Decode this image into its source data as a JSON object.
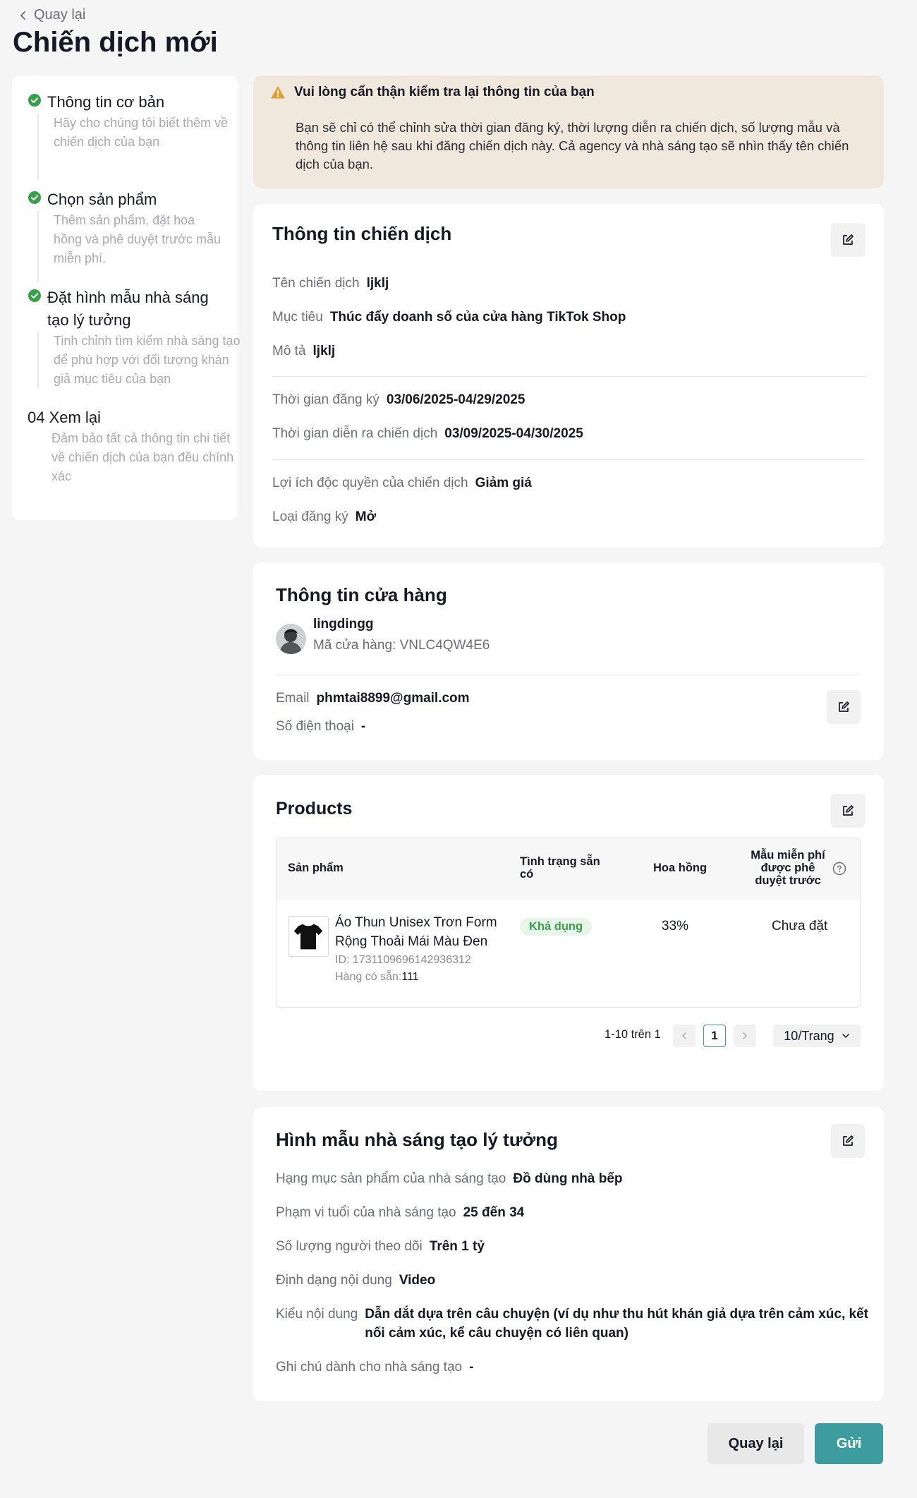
{
  "header": {
    "back_label": "Quay lại",
    "title": "Chiến dịch mới"
  },
  "steps": [
    {
      "title": "Thông tin cơ bản",
      "desc": "Hãy cho chúng tôi biết thêm về chiến dịch của bạn",
      "status": "done"
    },
    {
      "title": "Chọn sản phẩm",
      "desc": "Thêm sản phẩm, đặt hoa hồng và phê duyệt trước mẫu miễn phí.",
      "status": "done"
    },
    {
      "title": "Đặt hình mẫu nhà sáng tạo lý tưởng",
      "desc": "Tinh chỉnh tìm kiếm nhà sáng tạo để phù hợp với đối tượng khán giả mục tiêu của bạn",
      "status": "done"
    },
    {
      "title": "04 Xem lại",
      "desc": "Đảm bảo tất cả thông tin chi tiết về chiến dịch của bạn đều chính xác",
      "status": "current"
    }
  ],
  "warning": {
    "title": "Vui lòng cẩn thận kiểm tra lại thông tin của bạn",
    "body": "Bạn sẽ chỉ có thể chỉnh sửa thời gian đăng ký, thời lượng diễn ra chiến dịch, số lượng mẫu và thông tin liên hệ sau khi đăng chiến dịch này. Cả agency và nhà sáng tạo sẽ nhìn thấy tên chiến dịch của bạn."
  },
  "campaign": {
    "title": "Thông tin chiến dịch",
    "name_label": "Tên chiến dịch",
    "name": "ljklj",
    "goal_label": "Mục tiêu",
    "goal": "Thúc đẩy doanh số của cửa hàng TikTok Shop",
    "desc_label": "Mô tả",
    "desc": "ljklj",
    "reg_label": "Thời gian đăng ký",
    "reg": "03/06/2025-04/29/2025",
    "run_label": "Thời gian diễn ra chiến dịch",
    "run": "03/09/2025-04/30/2025",
    "benefit_label": "Lợi ích độc quyền của chiến dịch",
    "benefit": "Giảm giá",
    "type_label": "Loại đăng ký",
    "type": "Mở"
  },
  "shop": {
    "title": "Thông tin cửa hàng",
    "name": "lingdingg",
    "code": "Mã cửa hàng: VNLC4QW4E6",
    "email_label": "Email",
    "email": "phmtai8899@gmail.com",
    "phone_label": "Số điện thoại",
    "phone": "-"
  },
  "products": {
    "title": "Products",
    "columns": {
      "product": "Sản phẩm",
      "status_l1": "Tình trạng sẵn",
      "status_l2": "có",
      "commission": "Hoa hồng",
      "sample_l1": "Mẫu miễn phí",
      "sample_l2": "được phê",
      "sample_l3": "duyệt trước"
    },
    "rows": [
      {
        "name_l1": "Áo Thun Unisex Trơn Form",
        "name_l2": "Rộng Thoải Mái Màu Đen",
        "id": "ID: 1731109696142936312",
        "stock_label": "Hàng có sẵn:",
        "stock": "111",
        "status": "Khả dụng",
        "commission": "33%",
        "sample": "Chưa đặt"
      }
    ],
    "pagination": {
      "range": "1-10 trên 1",
      "current": "1",
      "page_size": "10/Trang"
    }
  },
  "creator": {
    "title": "Hình mẫu nhà sáng tạo lý tưởng",
    "category_label": "Hạng mục sản phẩm của nhà sáng tạo",
    "category": "Đồ dùng nhà bếp",
    "age_label": "Phạm vi tuổi của nhà sáng tạo",
    "age": "25 đến 34",
    "followers_label": "Số lượng người theo dõi",
    "followers": "Trên 1 tỷ",
    "format_label": "Định dạng nội dung",
    "format": "Video",
    "style_label": "Kiểu nội dung",
    "style_l1": "Dẫn dắt dựa trên câu chuyện (ví dụ như thu hút khán giả dựa trên cảm xúc, kết",
    "style_l2": "nối cảm xúc, kể câu chuyện có liên quan)",
    "note_label": "Ghi chú dành cho nhà sáng tạo",
    "note": "-"
  },
  "footer": {
    "back_label": "Quay lại",
    "submit_label": "Gửi"
  },
  "colors": {
    "accent": "#3d9c9d",
    "success": "#35a24a",
    "warning_bg": "#f1e8dd",
    "warning_icon": "#e0a132"
  }
}
